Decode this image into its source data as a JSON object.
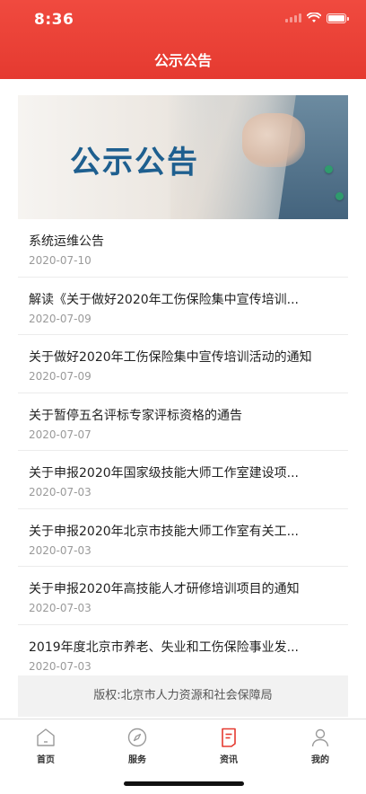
{
  "status": {
    "time": "8:36"
  },
  "header": {
    "title": "公示公告"
  },
  "banner": {
    "text": "公示公告"
  },
  "announcements": [
    {
      "title": "系统运维公告",
      "date": "2020-07-10"
    },
    {
      "title": "解读《关于做好2020年工伤保险集中宣传培训...",
      "date": "2020-07-09"
    },
    {
      "title": "关于做好2020年工伤保险集中宣传培训活动的通知",
      "date": "2020-07-09"
    },
    {
      "title": "关于暂停五名评标专家评标资格的通告",
      "date": "2020-07-07"
    },
    {
      "title": "关于申报2020年国家级技能大师工作室建设项...",
      "date": "2020-07-03"
    },
    {
      "title": "关于申报2020年北京市技能大师工作室有关工...",
      "date": "2020-07-03"
    },
    {
      "title": "关于申报2020年高技能人才研修培训项目的通知",
      "date": "2020-07-03"
    },
    {
      "title": "2019年度北京市养老、失业和工伤保险事业发...",
      "date": "2020-07-03"
    }
  ],
  "footer": {
    "copyright": "版权:北京市人力资源和社会保障局"
  },
  "tabs": [
    {
      "label": "首页",
      "icon": "home-icon"
    },
    {
      "label": "服务",
      "icon": "compass-icon"
    },
    {
      "label": "资讯",
      "icon": "document-icon",
      "active": true
    },
    {
      "label": "我的",
      "icon": "person-icon"
    }
  ],
  "colors": {
    "brand_red": "#e53a30",
    "active_icon": "#e53a30",
    "inactive_icon": "#9a9a9a"
  }
}
